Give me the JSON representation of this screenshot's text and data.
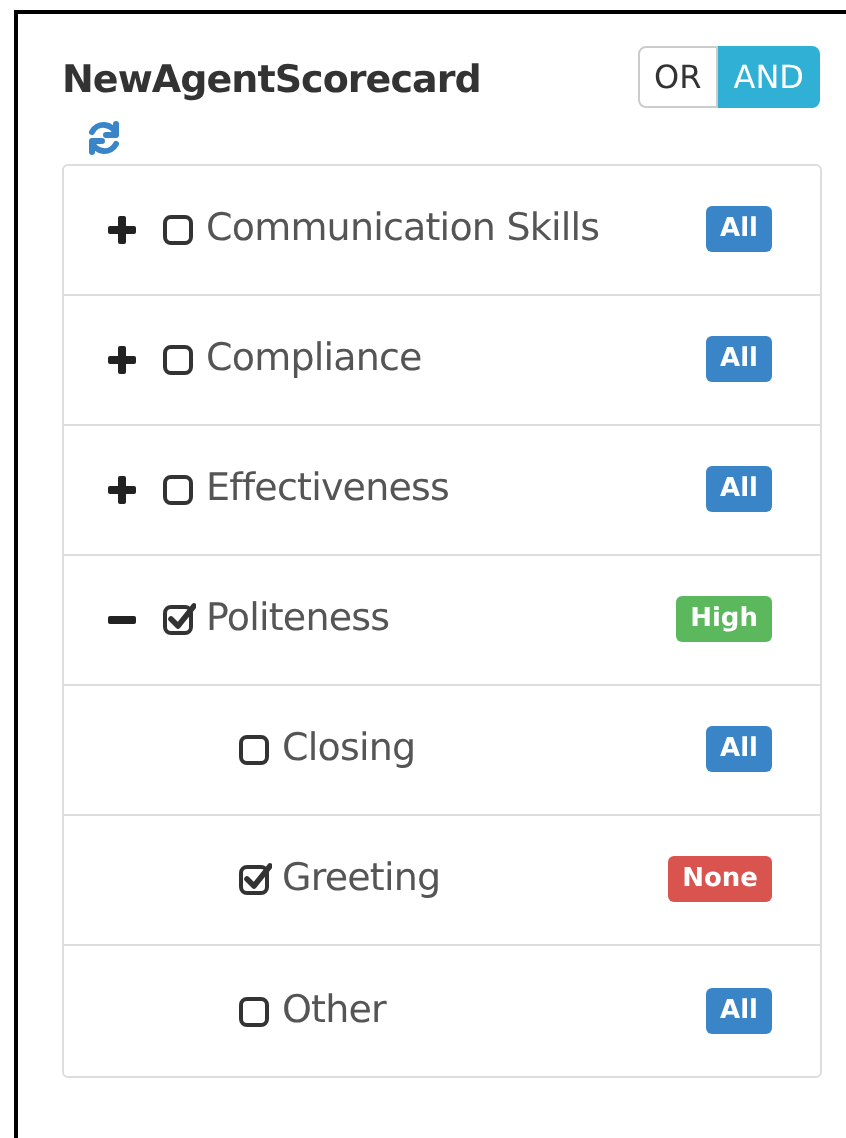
{
  "title": "NewAgentScorecard",
  "logic_toggle": [
    {
      "label": "OR",
      "selected": false
    },
    {
      "label": "AND",
      "selected": true
    }
  ],
  "categories": [
    {
      "label": "Communication Skills",
      "expanded": false,
      "checked": false,
      "badge": {
        "text": "All",
        "color": "#3a85c8"
      }
    },
    {
      "label": "Compliance",
      "expanded": false,
      "checked": false,
      "badge": {
        "text": "All",
        "color": "#3a85c8"
      }
    },
    {
      "label": "Effectiveness",
      "expanded": false,
      "checked": false,
      "badge": {
        "text": "All",
        "color": "#3a85c8"
      }
    },
    {
      "label": "Politeness",
      "expanded": true,
      "checked": true,
      "badge": {
        "text": "High",
        "color": "#5cb85c"
      },
      "children": [
        {
          "label": "Closing",
          "checked": false,
          "badge": {
            "text": "All",
            "color": "#3a85c8"
          }
        },
        {
          "label": "Greeting",
          "checked": true,
          "badge": {
            "text": "None",
            "color": "#d9534f"
          }
        },
        {
          "label": "Other",
          "checked": false,
          "badge": {
            "text": "All",
            "color": "#3a85c8"
          }
        }
      ]
    }
  ]
}
